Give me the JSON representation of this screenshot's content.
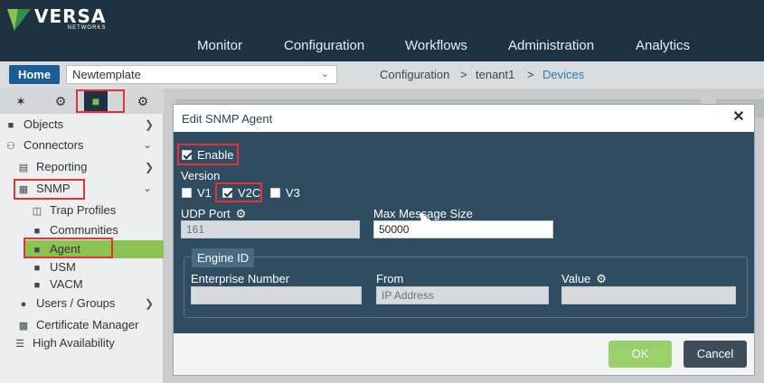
{
  "header": {
    "brand": "VERSA",
    "brand_sub": "NETWORKS",
    "nav": [
      "Monitor",
      "Configuration",
      "Workflows",
      "Administration",
      "Analytics"
    ]
  },
  "subbar": {
    "home_label": "Home",
    "template_value": "Newtemplate",
    "breadcrumb": [
      "Configuration",
      ">",
      "tenant1",
      ">",
      "Devices"
    ]
  },
  "sidebar": {
    "items": [
      {
        "label": "Objects",
        "icon": "cube-icon"
      },
      {
        "label": "Connectors",
        "icon": "connectors-icon"
      },
      {
        "label": "Reporting",
        "icon": "chart-icon"
      },
      {
        "label": "SNMP",
        "icon": "snmp-icon"
      },
      {
        "label": "Trap Profiles",
        "icon": "trap-icon"
      },
      {
        "label": "Communities",
        "icon": "cube-icon"
      },
      {
        "label": "Agent",
        "icon": "cube-icon"
      },
      {
        "label": "USM",
        "icon": "cube-icon"
      },
      {
        "label": "VACM",
        "icon": "cube-icon"
      },
      {
        "label": "Users / Groups",
        "icon": "users-icon"
      },
      {
        "label": "Certificate Manager",
        "icon": "certificate-icon"
      },
      {
        "label": "High Availability",
        "icon": "ha-icon"
      }
    ]
  },
  "dialog": {
    "title": "Edit SNMP Agent",
    "enable_label": "Enable",
    "version_label": "Version",
    "versions": [
      "V1",
      "V2C",
      "V3"
    ],
    "udp_port_label": "UDP Port",
    "udp_port_value": "161",
    "max_msg_label": "Max Message Size",
    "max_msg_value": "50000",
    "engine_id_label": "Engine ID",
    "enterprise_label": "Enterprise Number",
    "from_label": "From",
    "from_placeholder": "IP Address",
    "value_label": "Value",
    "ok_label": "OK",
    "cancel_label": "Cancel"
  },
  "colors": {
    "header_bg": "#1f3242",
    "accent_green": "#8cc251",
    "highlight_red": "#e2323a",
    "dialog_bg": "#2f4c60"
  }
}
